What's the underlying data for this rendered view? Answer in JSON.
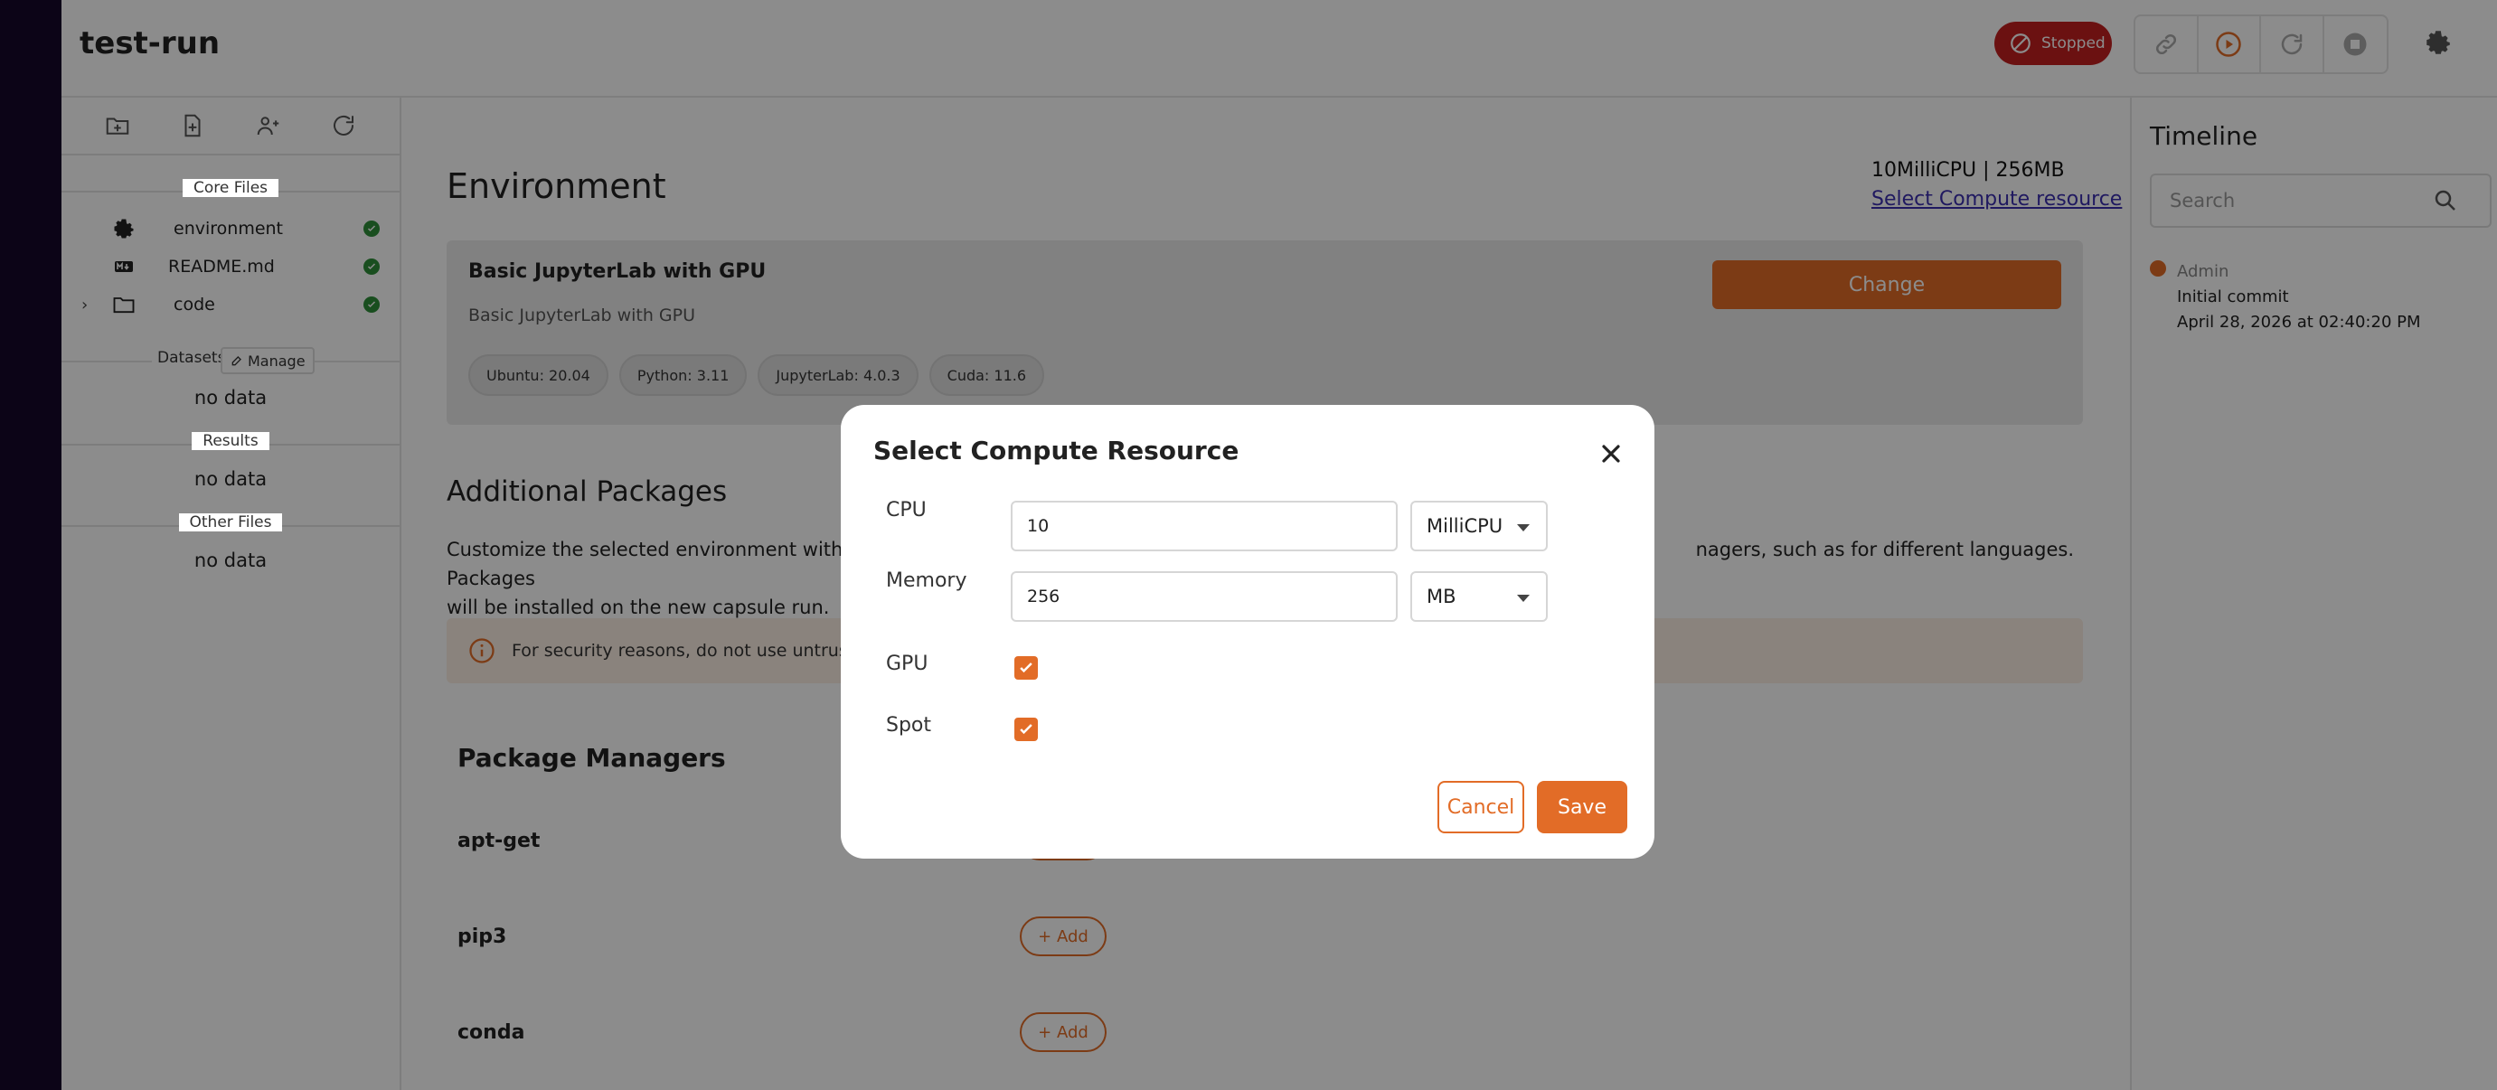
{
  "app": {
    "title": "test-run",
    "status": "Stopped"
  },
  "sidebar": {
    "core_files_label": "Core Files",
    "files": [
      {
        "name": "environment",
        "icon": "gear-icon"
      },
      {
        "name": "README.md",
        "icon": "markdown-icon"
      },
      {
        "name": "code",
        "icon": "folder-icon"
      }
    ],
    "datasets_label": "Datasets",
    "manage_label": "Manage",
    "datasets_empty": "no data",
    "results_label": "Results",
    "results_empty": "no data",
    "other_files_label": "Other Files",
    "other_files_empty": "no data"
  },
  "main": {
    "env_title": "Environment",
    "resource_summary": "10MilliCPU | 256MB",
    "select_resource_link": "Select Compute resource",
    "env_card": {
      "title": "Basic JupyterLab with GPU",
      "description": "Basic JupyterLab with GPU",
      "change_label": "Change",
      "tags": [
        "Ubuntu: 20.04",
        "Python: 3.11",
        "JupyterLab: 4.0.3",
        "Cuda: 11.6"
      ]
    },
    "additional_title": "Additional Packages",
    "additional_desc_start": "Customize the selected environment with any",
    "additional_desc_end": "nagers, such as for different languages. Packages",
    "additional_desc_line2": "will be installed on the new capsule run.",
    "warning_text": "For security reasons, do not use untrusted p",
    "package_managers_title": "Package Managers",
    "package_managers": [
      "apt-get",
      "pip3",
      "conda"
    ],
    "add_label": "+ Add"
  },
  "timeline": {
    "title": "Timeline",
    "search_placeholder": "Search",
    "entries": [
      {
        "author": "Admin",
        "message": "Initial commit",
        "date": "April 28, 2026 at 02:40:20 PM"
      }
    ]
  },
  "modal": {
    "title": "Select Compute Resource",
    "cpu_label": "CPU",
    "cpu_value": "10",
    "cpu_unit": "MilliCPU",
    "memory_label": "Memory",
    "memory_value": "256",
    "memory_unit": "MB",
    "gpu_label": "GPU",
    "gpu_checked": true,
    "spot_label": "Spot",
    "spot_checked": true,
    "cancel_label": "Cancel",
    "save_label": "Save"
  },
  "colors": {
    "accent": "#e26c27",
    "status_stopped": "#c32020",
    "success": "#2f8f3a",
    "link": "#3b2fb0"
  }
}
